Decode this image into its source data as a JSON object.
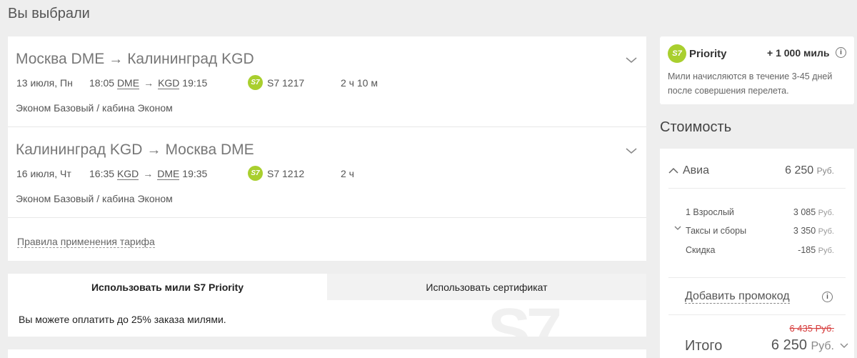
{
  "page": {
    "title": "Вы выбрали"
  },
  "segments": [
    {
      "from": "Москва DME",
      "to": "Калининград KGD",
      "date": "13 июля, Пн",
      "dep_time": "18:05",
      "dep_code": "DME",
      "arr_code": "KGD",
      "arr_time": "19:15",
      "flight": "S7 1217",
      "duration": "2 ч 10 м",
      "cabin": "Эконом Базовый / кабина Эконом"
    },
    {
      "from": "Калининград KGD",
      "to": "Москва DME",
      "date": "16 июля, Чт",
      "dep_time": "16:35",
      "dep_code": "KGD",
      "arr_code": "DME",
      "arr_time": "19:35",
      "flight": "S7 1212",
      "duration": "2 ч",
      "cabin": "Эконом Базовый / кабина Эконом"
    }
  ],
  "rules_link": "Правила применения тарифа",
  "miles_tabs": {
    "tab1": "Использовать мили S7 Priority",
    "tab2": "Использовать сертификат",
    "text": "Вы можете оплатить до 25% заказа милями."
  },
  "priority": {
    "logo_badge": "S7",
    "logo_text": "Priority",
    "miles": "+ 1 000 миль",
    "info": "i",
    "desc": "Мили начисляются в течение 3-45 дней после совершения перелета."
  },
  "cost": {
    "title": "Стоимость",
    "avia_label": "Авиа",
    "avia_price": "6 250",
    "currency": "Руб.",
    "lines": [
      {
        "label": "1 Взрослый",
        "value": "3 085"
      },
      {
        "label": "Таксы и сборы",
        "value": "3 350"
      },
      {
        "label": "Скидка",
        "value": "-185"
      }
    ],
    "promo": "Добавить промокод",
    "old_total": "6 435 Руб.",
    "total_label": "Итого",
    "total_price": "6 250"
  },
  "colors": {
    "s7_green": "#a9cf2e",
    "strike_red": "#d63c3c"
  }
}
